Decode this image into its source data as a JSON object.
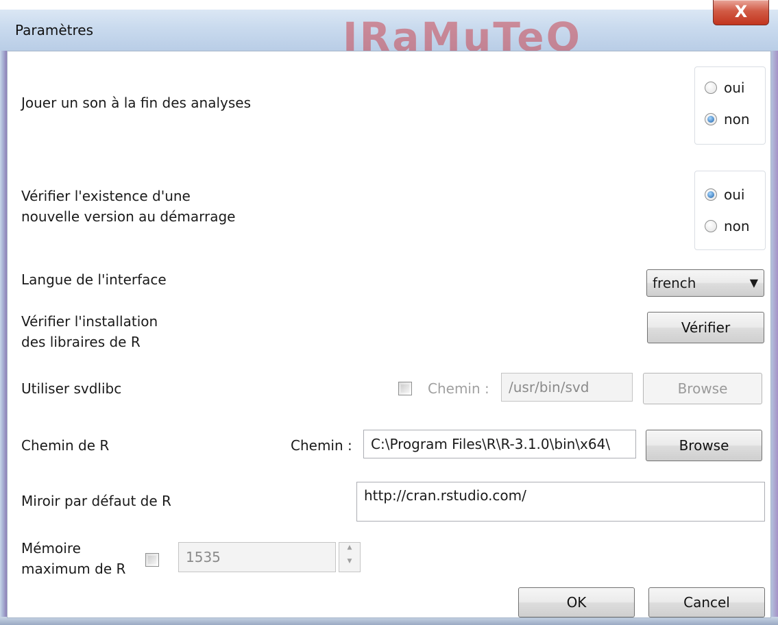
{
  "window": {
    "title": "Paramètres",
    "watermark": "IRaMuTeQ",
    "close_glyph": "X"
  },
  "settings": {
    "sound": {
      "label": "Jouer un son à la fin des analyses",
      "options": [
        "oui",
        "non"
      ],
      "selected": "non"
    },
    "update_check": {
      "label_line1": "Vérifier l'existence d'une",
      "label_line2": "nouvelle version au démarrage",
      "options": [
        "oui",
        "non"
      ],
      "selected": "oui"
    },
    "language": {
      "label": "Langue de l'interface",
      "value": "french"
    },
    "libraries": {
      "label_line1": "Vérifier l'installation",
      "label_line2": "des libraires de R",
      "button": "Vérifier"
    },
    "svdlibc": {
      "label": "Utiliser svdlibc",
      "path_label": "Chemin :",
      "path_value": "/usr/bin/svd",
      "browse": "Browse",
      "enabled": false
    },
    "r_path": {
      "label": "Chemin de R",
      "path_label": "Chemin :",
      "path_value": "C:\\Program Files\\R\\R-3.1.0\\bin\\x64\\",
      "browse": "Browse"
    },
    "mirror": {
      "label": "Miroir par défaut de R",
      "value": "http://cran.rstudio.com/"
    },
    "memory": {
      "label_line1": "Mémoire",
      "label_line2": "maximum de R",
      "value": "1535",
      "enabled": false
    }
  },
  "footer": {
    "ok": "OK",
    "cancel": "Cancel"
  },
  "colors": {
    "titlebar": "#c9daee",
    "close_button": "#c2351e",
    "radio_selected": "#1b5fa8"
  }
}
